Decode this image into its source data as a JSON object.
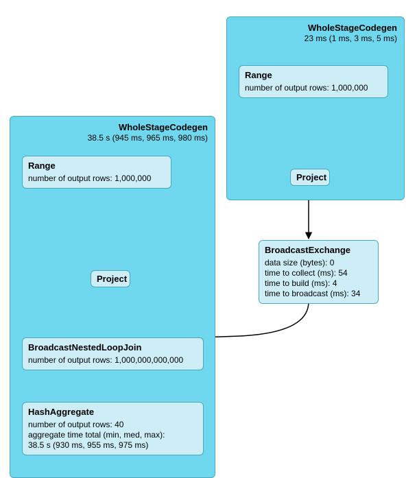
{
  "stageA": {
    "title": "WholeStageCodegen",
    "sub": "38.5 s (945 ms, 965 ms, 980 ms)"
  },
  "stageB": {
    "title": "WholeStageCodegen",
    "sub": "23 ms (1 ms, 3 ms, 5 ms)"
  },
  "nodes": {
    "rangeA": {
      "title": "Range",
      "body": "number of output rows: 1,000,000"
    },
    "projectA": {
      "title": "Project"
    },
    "nestedJoin": {
      "title": "BroadcastNestedLoopJoin",
      "body": "number of output rows: 1,000,000,000,000"
    },
    "hashAgg": {
      "title": "HashAggregate",
      "body": "number of output rows: 40\naggregate time total (min, med, max):\n38.5 s (930 ms, 955 ms, 975 ms)"
    },
    "rangeB": {
      "title": "Range",
      "body": "number of output rows: 1,000,000"
    },
    "projectB": {
      "title": "Project"
    },
    "bcastEx": {
      "title": "BroadcastExchange",
      "body": "data size (bytes): 0\ntime to collect (ms): 54\ntime to build (ms): 4\ntime to broadcast (ms): 34"
    }
  }
}
